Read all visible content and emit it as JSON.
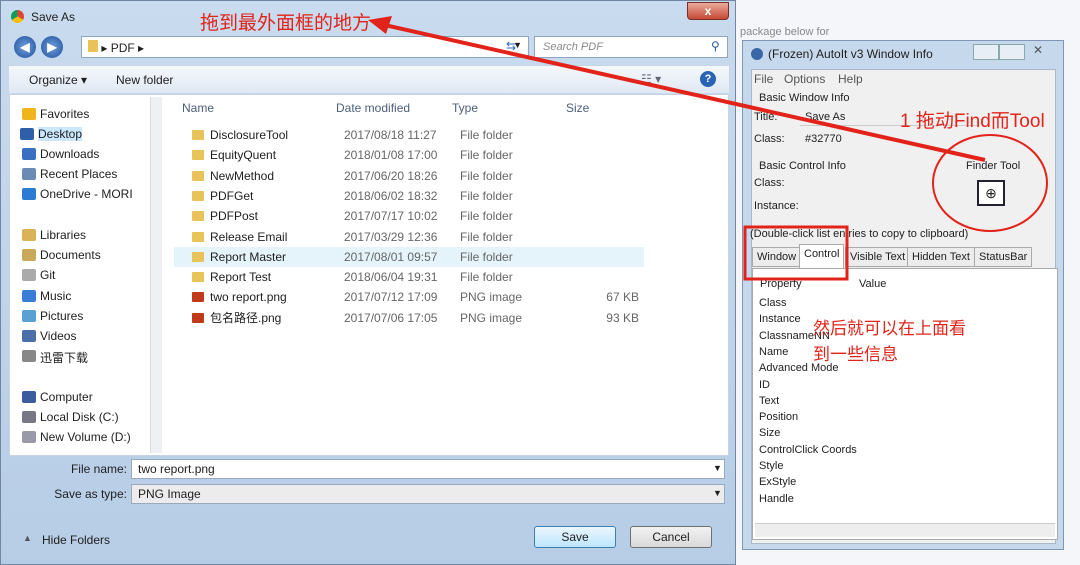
{
  "save_dialog": {
    "title": "Save As",
    "close": "x",
    "path": [
      "PDF"
    ],
    "search_placeholder": "Search PDF",
    "toolbar": {
      "organize": "Organize ▾",
      "new_folder": "New folder",
      "help": "?"
    },
    "sidebar": [
      {
        "label": "Favorites",
        "c": "#f0b51c"
      },
      {
        "label": "Desktop",
        "c": "#2f5fa8"
      },
      {
        "label": "Downloads",
        "c": "#3a6fc0"
      },
      {
        "label": "Recent Places",
        "c": "#6b8bb5"
      },
      {
        "label": "OneDrive - MORI",
        "c": "#2b7bd4"
      },
      {
        "label": "Libraries",
        "c": "#d9b25a"
      },
      {
        "label": "Documents",
        "c": "#c9a85a"
      },
      {
        "label": "Git",
        "c": "#aaa"
      },
      {
        "label": "Music",
        "c": "#3a7bd5"
      },
      {
        "label": "Pictures",
        "c": "#5aa0d0"
      },
      {
        "label": "Videos",
        "c": "#4b6fa8"
      },
      {
        "label": "迅雷下载",
        "c": "#888"
      },
      {
        "label": "Computer",
        "c": "#3b5da0"
      },
      {
        "label": "Local Disk (C:)",
        "c": "#778"
      },
      {
        "label": "New Volume (D:)",
        "c": "#99a"
      }
    ],
    "columns": [
      "Name",
      "Date modified",
      "Type",
      "Size"
    ],
    "files": [
      {
        "name": "DisclosureTool",
        "date": "2017/08/18 11:27",
        "type": "File folder",
        "size": ""
      },
      {
        "name": "EquityQuent",
        "date": "2018/01/08 17:00",
        "type": "File folder",
        "size": ""
      },
      {
        "name": "NewMethod",
        "date": "2017/06/20 18:26",
        "type": "File folder",
        "size": ""
      },
      {
        "name": "PDFGet",
        "date": "2018/06/02 18:32",
        "type": "File folder",
        "size": ""
      },
      {
        "name": "PDFPost",
        "date": "2017/07/17 10:02",
        "type": "File folder",
        "size": ""
      },
      {
        "name": "Release Email",
        "date": "2017/03/29 12:36",
        "type": "File folder",
        "size": ""
      },
      {
        "name": "Report Master",
        "date": "2017/08/01 09:57",
        "type": "File folder",
        "size": ""
      },
      {
        "name": "Report Test",
        "date": "2018/06/04 19:31",
        "type": "File folder",
        "size": ""
      },
      {
        "name": "two report.png",
        "date": "2017/07/12 17:09",
        "type": "PNG image",
        "size": "67 KB"
      },
      {
        "name": "包名路径.png",
        "date": "2017/07/06 17:05",
        "type": "PNG image",
        "size": "93 KB"
      }
    ],
    "file_name_label": "File name:",
    "file_name": "two report.png",
    "type_label": "Save as type:",
    "type_value": "PNG Image",
    "hide_folders": "Hide Folders",
    "save": "Save",
    "cancel": "Cancel"
  },
  "autoit": {
    "bg_text": "package below for",
    "title": "(Frozen) AutoIt v3 Window Info",
    "menu": [
      "File",
      "Options",
      "Help"
    ],
    "basic_window": "Basic Window Info",
    "title_label": "Title:",
    "title_value": "Save As",
    "class_label": "Class:",
    "class_value": "#32770",
    "basic_control": "Basic Control Info",
    "ctrl_class_label": "Class:",
    "instance_label": "Instance:",
    "finder_tool": "Finder Tool",
    "hint": "(Double-click list entries to copy to clipboard)",
    "tabs": [
      "Window",
      "Control",
      "Visible Text",
      "Hidden Text",
      "StatusBar"
    ],
    "list_headers": [
      "Property",
      "Value"
    ],
    "properties": [
      "Class",
      "Instance",
      "ClassnameNN",
      "Name",
      "Advanced Mode",
      "ID",
      "Text",
      "Position",
      "Size",
      "ControlClick Coords",
      "Style",
      "ExStyle",
      "Handle"
    ]
  },
  "annotations": {
    "top": "拖到最外面框的地方",
    "step1": "1 拖动Find而Tool",
    "step2a": "然后就可以在上面看",
    "step2b": "到一些信息"
  },
  "accent": "#e2231a"
}
